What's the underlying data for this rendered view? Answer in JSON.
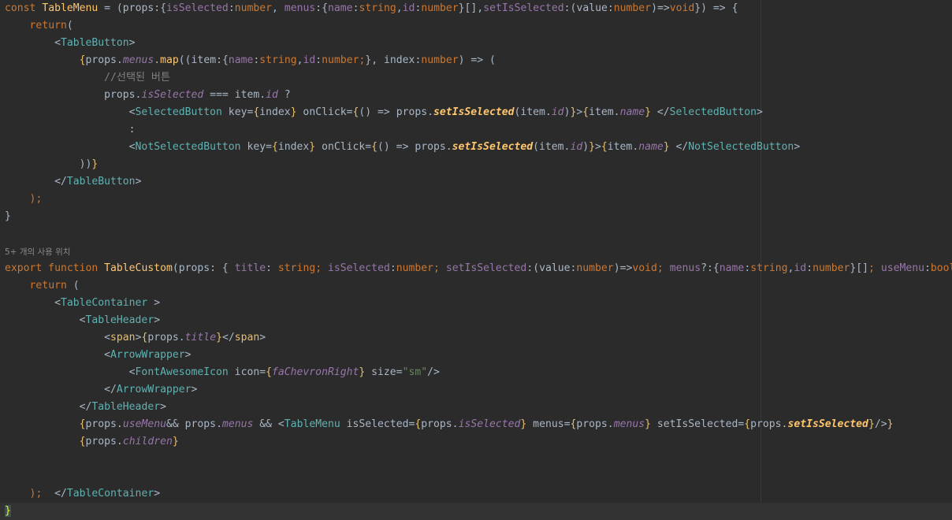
{
  "editor": {
    "usage_hint": "5+ 개의 사용 위치",
    "lines": [
      [
        [
          "kw",
          "const "
        ],
        [
          "fn",
          "TableMenu"
        ],
        [
          "plain",
          " = (props:{"
        ],
        [
          "param",
          "isSelected"
        ],
        [
          "plain",
          ":"
        ],
        [
          "kw",
          "number"
        ],
        [
          "plain",
          ", "
        ],
        [
          "param",
          "menus"
        ],
        [
          "plain",
          ":{"
        ],
        [
          "param",
          "name"
        ],
        [
          "plain",
          ":"
        ],
        [
          "kw",
          "string"
        ],
        [
          "plain",
          ","
        ],
        [
          "param",
          "id"
        ],
        [
          "plain",
          ":"
        ],
        [
          "kw",
          "number"
        ],
        [
          "plain",
          "}[],"
        ],
        [
          "param",
          "setIsSelected"
        ],
        [
          "plain",
          ":(value:"
        ],
        [
          "kw",
          "number"
        ],
        [
          "plain",
          ")=>"
        ],
        [
          "kw",
          "void"
        ],
        [
          "plain",
          "}) => {"
        ]
      ],
      [
        [
          "plain",
          "    "
        ],
        [
          "kw",
          "return"
        ],
        [
          "plain",
          "("
        ]
      ],
      [
        [
          "plain",
          "        <"
        ],
        [
          "comp",
          "TableButton"
        ],
        [
          "plain",
          ">"
        ]
      ],
      [
        [
          "plain",
          "            "
        ],
        [
          "brace",
          "{"
        ],
        [
          "plain",
          "props."
        ],
        [
          "prop",
          "menus"
        ],
        [
          "plain",
          "."
        ],
        [
          "fn",
          "map"
        ],
        [
          "plain",
          "((item:{"
        ],
        [
          "param",
          "name"
        ],
        [
          "plain",
          ":"
        ],
        [
          "kw",
          "string"
        ],
        [
          "plain",
          ","
        ],
        [
          "param",
          "id"
        ],
        [
          "plain",
          ":"
        ],
        [
          "kw",
          "number"
        ],
        [
          "kw",
          ";"
        ],
        [
          "plain",
          "}, index:"
        ],
        [
          "kw",
          "number"
        ],
        [
          "plain",
          ") => ("
        ]
      ],
      [
        [
          "plain",
          "                "
        ],
        [
          "cmt",
          "//선택된 버튼"
        ]
      ],
      [
        [
          "plain",
          "                props."
        ],
        [
          "prop",
          "isSelected"
        ],
        [
          "plain",
          " === item."
        ],
        [
          "prop",
          "id"
        ],
        [
          "plain",
          " ?"
        ]
      ],
      [
        [
          "plain",
          "                    <"
        ],
        [
          "comp",
          "SelectedButton"
        ],
        [
          "plain",
          " key="
        ],
        [
          "brace",
          "{"
        ],
        [
          "plain",
          "index"
        ],
        [
          "brace",
          "}"
        ],
        [
          "plain",
          " onClick="
        ],
        [
          "brace",
          "{"
        ],
        [
          "plain",
          "() => props."
        ],
        [
          "call",
          "setIsSelected"
        ],
        [
          "plain",
          "(item."
        ],
        [
          "prop",
          "id"
        ],
        [
          "plain",
          ")"
        ],
        [
          "brace",
          "}"
        ],
        [
          "plain",
          ">"
        ],
        [
          "brace",
          "{"
        ],
        [
          "plain",
          "item."
        ],
        [
          "prop",
          "name"
        ],
        [
          "brace",
          "}"
        ],
        [
          "plain",
          " </"
        ],
        [
          "comp",
          "SelectedButton"
        ],
        [
          "plain",
          ">"
        ]
      ],
      [
        [
          "plain",
          "                    :"
        ]
      ],
      [
        [
          "plain",
          "                    <"
        ],
        [
          "comp",
          "NotSelectedButton"
        ],
        [
          "plain",
          " key="
        ],
        [
          "brace",
          "{"
        ],
        [
          "plain",
          "index"
        ],
        [
          "brace",
          "}"
        ],
        [
          "plain",
          " onClick="
        ],
        [
          "brace",
          "{"
        ],
        [
          "plain",
          "() => props."
        ],
        [
          "call",
          "setIsSelected"
        ],
        [
          "plain",
          "(item."
        ],
        [
          "prop",
          "id"
        ],
        [
          "plain",
          ")"
        ],
        [
          "brace",
          "}"
        ],
        [
          "plain",
          ">"
        ],
        [
          "brace",
          "{"
        ],
        [
          "plain",
          "item."
        ],
        [
          "prop",
          "name"
        ],
        [
          "brace",
          "}"
        ],
        [
          "plain",
          " </"
        ],
        [
          "comp",
          "NotSelectedButton"
        ],
        [
          "plain",
          ">"
        ]
      ],
      [
        [
          "plain",
          "            ))"
        ],
        [
          "brace",
          "}"
        ]
      ],
      [
        [
          "plain",
          "        </"
        ],
        [
          "comp",
          "TableButton"
        ],
        [
          "plain",
          ">"
        ]
      ],
      [
        [
          "plain",
          "    "
        ],
        [
          "kw",
          ")"
        ],
        [
          "kw",
          ";"
        ]
      ],
      [
        [
          "plain",
          "}"
        ]
      ],
      [
        [
          "plain",
          ""
        ]
      ],
      [
        [
          "plain",
          ""
        ]
      ],
      [
        [
          "kw",
          "export function "
        ],
        [
          "fn",
          "TableCustom"
        ],
        [
          "plain",
          "(props: { "
        ],
        [
          "param",
          "title"
        ],
        [
          "plain",
          ": "
        ],
        [
          "kw",
          "string"
        ],
        [
          "kw",
          "; "
        ],
        [
          "param",
          "isSelected"
        ],
        [
          "plain",
          ":"
        ],
        [
          "kw",
          "number"
        ],
        [
          "kw",
          "; "
        ],
        [
          "param",
          "setIsSelected"
        ],
        [
          "plain",
          ":(value:"
        ],
        [
          "kw",
          "number"
        ],
        [
          "plain",
          ")=>"
        ],
        [
          "kw",
          "void"
        ],
        [
          "kw",
          "; "
        ],
        [
          "param",
          "menus"
        ],
        [
          "plain",
          "?:{"
        ],
        [
          "param",
          "name"
        ],
        [
          "plain",
          ":"
        ],
        [
          "kw",
          "string"
        ],
        [
          "plain",
          ","
        ],
        [
          "param",
          "id"
        ],
        [
          "plain",
          ":"
        ],
        [
          "kw",
          "number"
        ],
        [
          "plain",
          "}[]"
        ],
        [
          "kw",
          "; "
        ],
        [
          "param",
          "useMenu"
        ],
        [
          "plain",
          ":"
        ],
        [
          "kw",
          "boolean"
        ]
      ],
      [
        [
          "plain",
          "    "
        ],
        [
          "kw",
          "return"
        ],
        [
          "plain",
          " ("
        ]
      ],
      [
        [
          "plain",
          "        <"
        ],
        [
          "comp",
          "TableContainer"
        ],
        [
          "plain",
          " >"
        ]
      ],
      [
        [
          "plain",
          "            <"
        ],
        [
          "comp",
          "TableHeader"
        ],
        [
          "plain",
          ">"
        ]
      ],
      [
        [
          "plain",
          "                <"
        ],
        [
          "tag",
          "span"
        ],
        [
          "plain",
          ">"
        ],
        [
          "brace",
          "{"
        ],
        [
          "plain",
          "props."
        ],
        [
          "prop",
          "title"
        ],
        [
          "brace",
          "}"
        ],
        [
          "plain",
          "</"
        ],
        [
          "tag",
          "span"
        ],
        [
          "plain",
          ">"
        ]
      ],
      [
        [
          "plain",
          "                <"
        ],
        [
          "comp",
          "ArrowWrapper"
        ],
        [
          "plain",
          ">"
        ]
      ],
      [
        [
          "plain",
          "                    <"
        ],
        [
          "comp",
          "FontAwesomeIcon"
        ],
        [
          "plain",
          " icon="
        ],
        [
          "brace",
          "{"
        ],
        [
          "prop",
          "faChevronRight"
        ],
        [
          "brace",
          "}"
        ],
        [
          "plain",
          " size="
        ],
        [
          "str",
          "\"sm\""
        ],
        [
          "plain",
          "/>"
        ]
      ],
      [
        [
          "plain",
          "                </"
        ],
        [
          "comp",
          "ArrowWrapper"
        ],
        [
          "plain",
          ">"
        ]
      ],
      [
        [
          "plain",
          "            </"
        ],
        [
          "comp",
          "TableHeader"
        ],
        [
          "plain",
          ">"
        ]
      ],
      [
        [
          "plain",
          "            "
        ],
        [
          "brace",
          "{"
        ],
        [
          "plain",
          "props."
        ],
        [
          "prop",
          "useMenu"
        ],
        [
          "plain",
          "&& props."
        ],
        [
          "prop",
          "menus"
        ],
        [
          "plain",
          " && <"
        ],
        [
          "comp",
          "TableMenu"
        ],
        [
          "plain",
          " isSelected="
        ],
        [
          "brace",
          "{"
        ],
        [
          "plain",
          "props."
        ],
        [
          "prop",
          "isSelected"
        ],
        [
          "brace",
          "}"
        ],
        [
          "plain",
          " menus="
        ],
        [
          "brace",
          "{"
        ],
        [
          "plain",
          "props."
        ],
        [
          "prop",
          "menus"
        ],
        [
          "brace",
          "}"
        ],
        [
          "plain",
          " setIsSelected="
        ],
        [
          "brace",
          "{"
        ],
        [
          "plain",
          "props."
        ],
        [
          "call",
          "setIsSelected"
        ],
        [
          "brace",
          "}"
        ],
        [
          "plain",
          "/>"
        ],
        [
          "brace",
          "}"
        ]
      ],
      [
        [
          "plain",
          "            "
        ],
        [
          "brace",
          "{"
        ],
        [
          "plain",
          "props."
        ],
        [
          "prop",
          "children"
        ],
        [
          "brace",
          "}"
        ]
      ],
      [
        [
          "plain",
          "        </"
        ],
        [
          "comp",
          "TableContainer"
        ],
        [
          "plain",
          ">"
        ]
      ],
      [
        [
          "plain",
          ""
        ]
      ],
      [
        [
          "plain",
          "    "
        ],
        [
          "kw",
          ")"
        ],
        [
          "kw",
          ";"
        ]
      ],
      [
        [
          "bracket",
          "}"
        ]
      ]
    ]
  }
}
